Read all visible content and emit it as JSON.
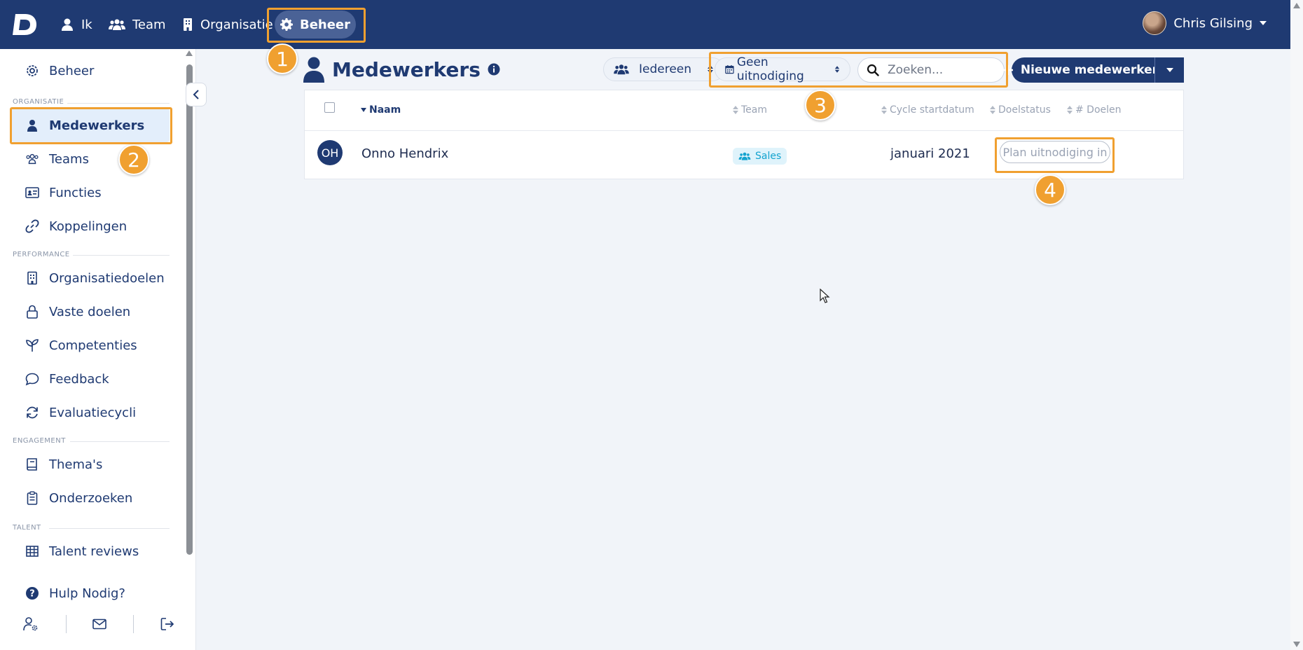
{
  "topbar": {
    "logo_letter": "D",
    "nav": [
      {
        "label": "Ik",
        "icon": "user-icon"
      },
      {
        "label": "Team",
        "icon": "users-icon"
      },
      {
        "label": "Organisatie",
        "icon": "building-icon"
      },
      {
        "label": "Beheer",
        "icon": "gear-icon",
        "active": true
      }
    ],
    "user_name": "Chris Gilsing"
  },
  "sidebar": {
    "top_item": "Beheer",
    "sections": [
      {
        "label": "ORGANISATIE",
        "items": [
          "Medewerkers",
          "Teams",
          "Functies",
          "Koppelingen"
        ]
      },
      {
        "label": "PERFORMANCE",
        "items": [
          "Organisatiedoelen",
          "Vaste doelen",
          "Competenties",
          "Feedback",
          "Evaluatiecycli"
        ]
      },
      {
        "label": "ENGAGEMENT",
        "items": [
          "Thema's",
          "Onderzoeken"
        ]
      },
      {
        "label": "TALENT",
        "items": [
          "Talent reviews"
        ]
      }
    ],
    "help": "Hulp Nodig?",
    "active_item": "Medewerkers"
  },
  "main": {
    "title": "Medewerkers",
    "filter_everyone": "Iedereen",
    "filter_invite": "Geen uitnodiging",
    "search_placeholder": "Zoeken...",
    "new_button": "Nieuwe medewerkers",
    "columns": [
      "Naam",
      "Team",
      "Cycle startdatum",
      "Doelstatus",
      "# Doelen"
    ],
    "rows": [
      {
        "initials": "OH",
        "name": "Onno Hendrix",
        "team": "Sales",
        "cycle_start": "januari 2021",
        "action": "Plan uitnodiging in"
      }
    ]
  },
  "annotations": [
    "1",
    "2",
    "3",
    "4"
  ],
  "colors": {
    "primary": "#1f3a72",
    "accent": "#f0a030",
    "badge": "#14a3cf"
  }
}
